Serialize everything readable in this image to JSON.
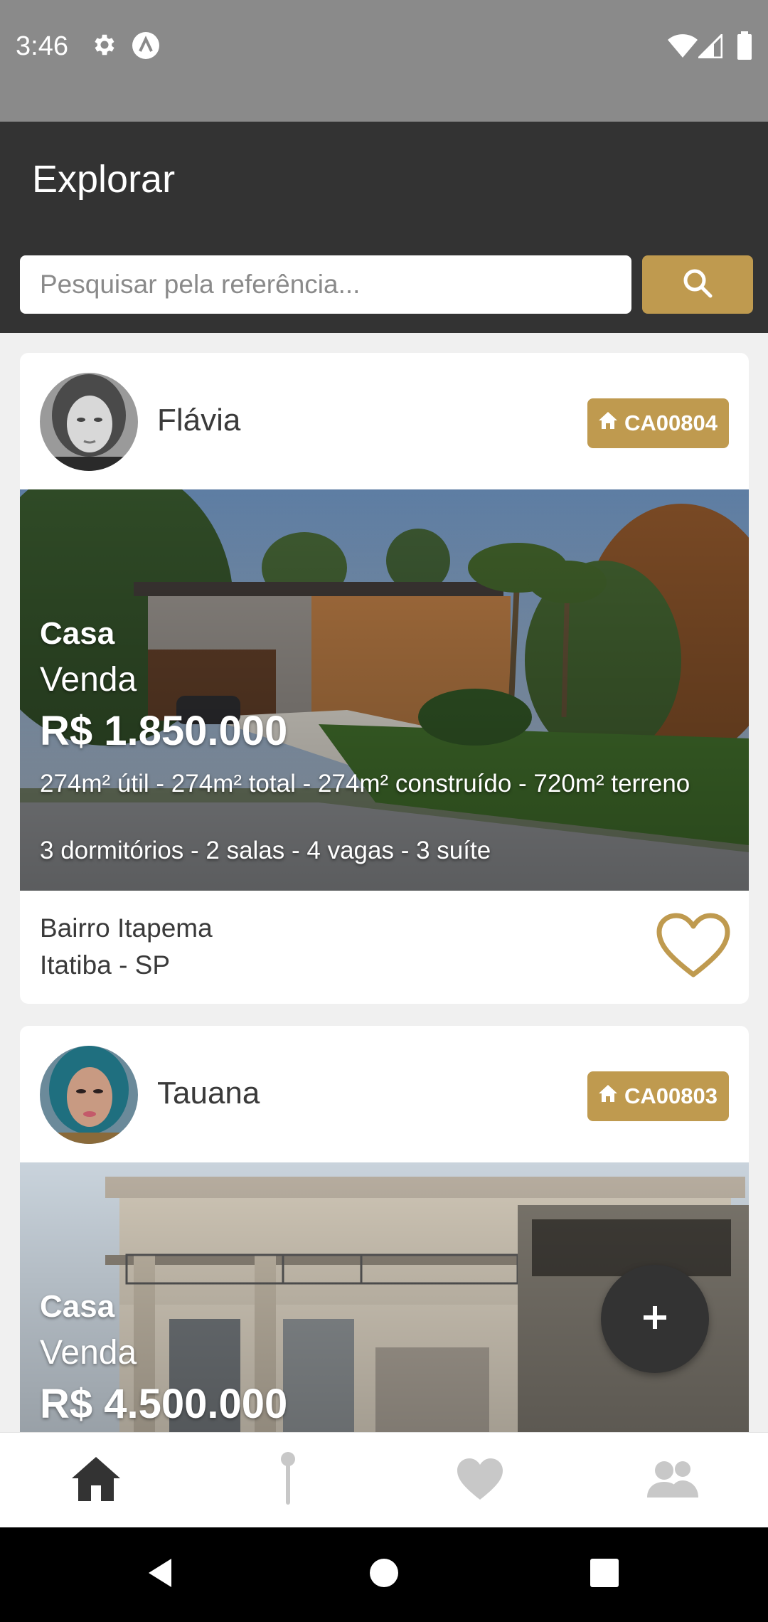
{
  "status_bar": {
    "time": "3:46",
    "icons": [
      "gear-icon",
      "a-circle-icon",
      "wifi-icon",
      "signal-icon",
      "battery-icon"
    ]
  },
  "app_bar": {
    "title": "Explorar"
  },
  "search": {
    "placeholder": "Pesquisar pela referência...",
    "value": "",
    "button_icon": "search-icon"
  },
  "colors": {
    "accent": "#bf9a4f",
    "appbar": "#333333",
    "status_bar": "#8a8a8a"
  },
  "listings": [
    {
      "owner": "Flávia",
      "reference": "CA00804",
      "type": "Casa",
      "deal": "Venda",
      "price": "R$ 1.850.000",
      "areas": "274m² útil - 274m² total - 274m² construído - 720m² terreno",
      "rooms": "3 dormitórios - 2 salas - 4 vagas - 3 suíte",
      "neighborhood": "Bairro Itapema",
      "city": "Itatiba - SP",
      "favorited": false
    },
    {
      "owner": "Tauana",
      "reference": "CA00803",
      "type": "Casa",
      "deal": "Venda",
      "price": "R$ 4.500.000"
    }
  ],
  "fab": {
    "icon": "plus-icon"
  },
  "bottom_nav": {
    "items": [
      {
        "name": "home",
        "icon": "home-icon",
        "active": true
      },
      {
        "name": "pin",
        "icon": "map-pin-icon",
        "active": false
      },
      {
        "name": "favorites",
        "icon": "heart-icon",
        "active": false
      },
      {
        "name": "users",
        "icon": "users-icon",
        "active": false
      }
    ]
  },
  "system_nav": {
    "icons": [
      "back-icon",
      "home-circle-icon",
      "recents-icon"
    ]
  }
}
